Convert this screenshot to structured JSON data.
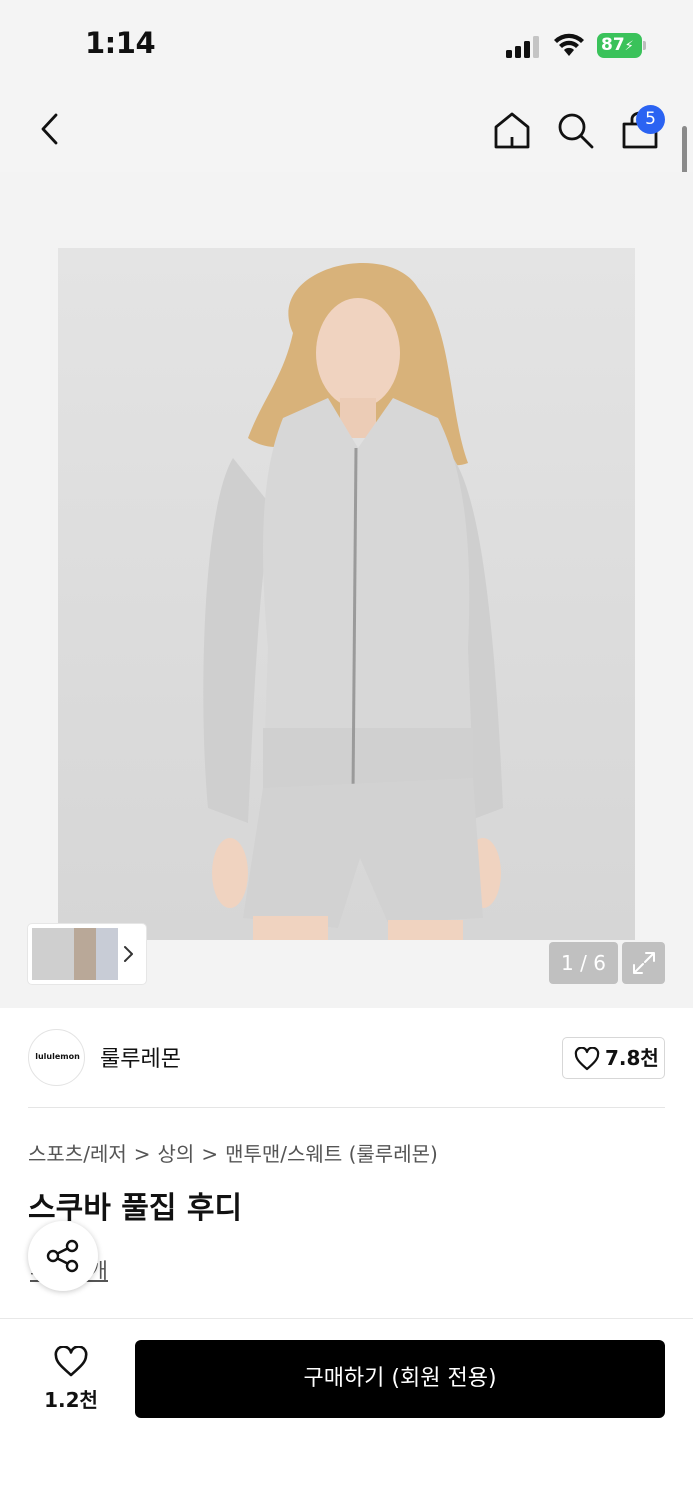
{
  "status_bar": {
    "time": "1:14",
    "battery_percent": "87",
    "battery_color": "#3ac25a"
  },
  "nav": {
    "back_icon": "chevron-left-icon",
    "home_icon": "home-icon",
    "search_icon": "search-icon",
    "cart_icon": "shopping-bag-icon",
    "cart_count": "5",
    "badge_color": "#2b63f2"
  },
  "gallery": {
    "counter": "1 / 6",
    "thumb_more_icon": "chevron-right-icon",
    "expand_icon": "expand-icon"
  },
  "brand": {
    "logo_text": "lululemon",
    "name": "룰루레몬",
    "like_icon": "heart-icon",
    "like_count": "7.8천"
  },
  "breadcrumb": {
    "items": [
      "스포츠/레저",
      "상의",
      "맨투맨/스웨트 (룰루레몬)"
    ],
    "separator": ">"
  },
  "product": {
    "title": "스쿠바 풀집 후디",
    "review_link": "후기 7개",
    "share_icon": "share-icon"
  },
  "bottom": {
    "wish_icon": "heart-icon",
    "wish_count": "1.2천",
    "buy_label": "구매하기 (회원 전용)"
  }
}
